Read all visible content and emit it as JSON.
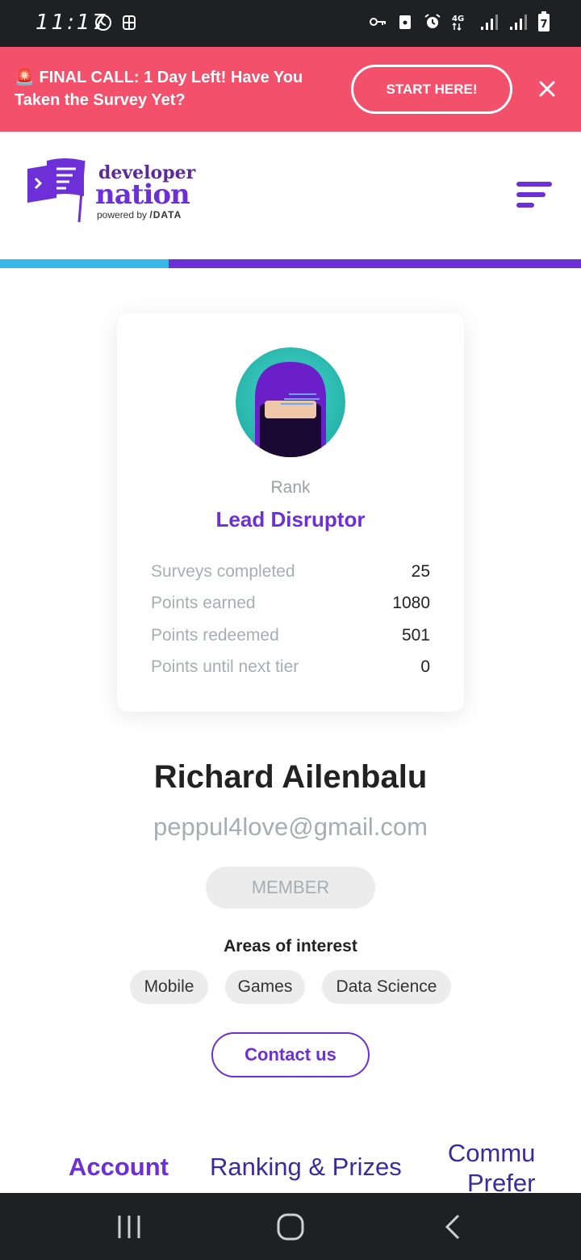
{
  "status_bar": {
    "time": "11:17",
    "network": "4G",
    "battery_level": "7"
  },
  "banner": {
    "emoji": "🚨",
    "message": "FINAL CALL: 1 Day Left! Have You Taken the Survey Yet?",
    "cta_label": "START HERE!",
    "close_icon": "close-icon"
  },
  "header": {
    "logo_line1": "developer",
    "logo_line2": "nation",
    "logo_powered": "powered by",
    "logo_brand": "/DATA",
    "menu_icon": "hamburger-menu-icon"
  },
  "progress": {
    "fraction": 0.29,
    "fill_color": "#35b7e8",
    "track_color": "#6c2fd8"
  },
  "profile_card": {
    "rank_label": "Rank",
    "rank_value": "Lead Disruptor",
    "stats": [
      {
        "label": "Surveys completed",
        "value": "25"
      },
      {
        "label": "Points earned",
        "value": "1080"
      },
      {
        "label": "Points redeemed",
        "value": "501"
      },
      {
        "label": "Points until next tier",
        "value": "0"
      }
    ]
  },
  "user": {
    "name": "Richard Ailenbalu",
    "email": "peppul4love@gmail.com",
    "role": "MEMBER"
  },
  "interests": {
    "title": "Areas of interest",
    "items": [
      "Mobile",
      "Games",
      "Data Science"
    ]
  },
  "contact_label": "Contact us",
  "tabs": [
    {
      "label": "Account",
      "active": true
    },
    {
      "label": "Ranking & Prizes",
      "active": false
    },
    {
      "label": "Commu",
      "label_line2": "Prefer",
      "active": false
    }
  ],
  "colors": {
    "brand_purple": "#6c2fd8",
    "banner_red": "#f2506b",
    "accent_blue": "#35b7e8"
  }
}
